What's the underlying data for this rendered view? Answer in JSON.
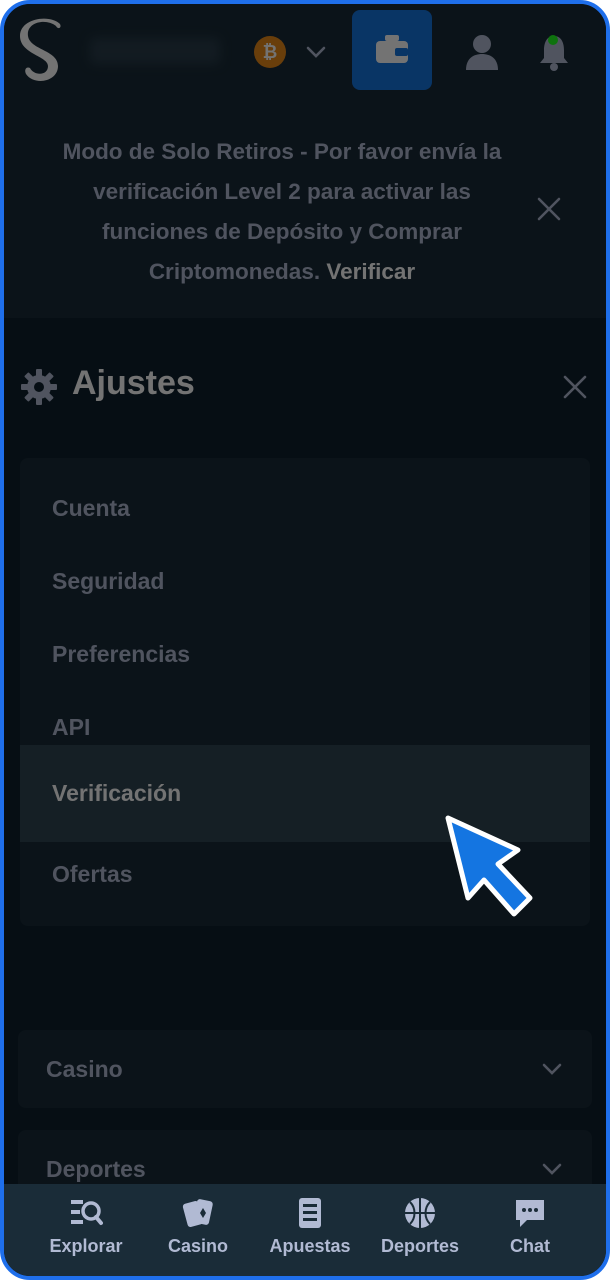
{
  "header": {
    "logo_letter": "S",
    "currency_symbol": "₿"
  },
  "banner": {
    "message": "Modo de Solo Retiros - Por favor envía la verificación Level 2 para activar las funciones de Depósito y Comprar Criptomonedas.",
    "link": "Verificar"
  },
  "settings": {
    "title": "Ajustes",
    "items": [
      {
        "label": "Cuenta"
      },
      {
        "label": "Seguridad"
      },
      {
        "label": "Preferencias"
      },
      {
        "label": "API"
      },
      {
        "label": "Verificación",
        "active": true
      },
      {
        "label": "Ofertas"
      }
    ]
  },
  "sections": {
    "casino": "Casino",
    "deportes": "Deportes"
  },
  "bottom_nav": {
    "explorar": "Explorar",
    "casino": "Casino",
    "apuestas": "Apuestas",
    "deportes": "Deportes",
    "chat": "Chat"
  },
  "colors": {
    "accent": "#1475e1",
    "background": "#0f212e",
    "surface": "#1a2c38",
    "text_muted": "#b1bad3",
    "btc": "#e88a1a",
    "online": "#1fff20"
  }
}
